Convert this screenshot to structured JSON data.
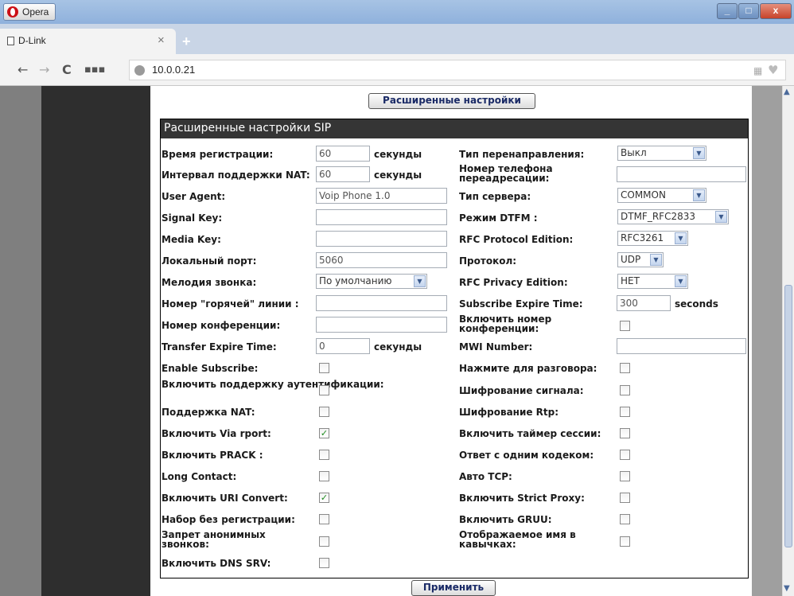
{
  "browser": {
    "menu_label": "Opera",
    "tab_title": "D-Link",
    "address": "10.0.0.21",
    "new_tab_glyph": "+",
    "close_glyph": "×"
  },
  "page": {
    "advanced_button": "Расширенные настройки",
    "section_title": "Расширенные настройки SIP",
    "apply_button": "Применить",
    "left": {
      "reg_time_label": "Время регистрации:",
      "reg_time_value": "60",
      "reg_time_unit": "секунды",
      "nat_interval_label": "Интервал поддержки NAT:",
      "nat_interval_value": "60",
      "nat_interval_unit": "секунды",
      "user_agent_label": "User Agent:",
      "user_agent_value": "Voip Phone 1.0",
      "signal_key_label": "Signal Key:",
      "signal_key_value": "",
      "media_key_label": "Media Key:",
      "media_key_value": "",
      "local_port_label": "Локальный порт:",
      "local_port_value": "5060",
      "ringtone_label": "Мелодия звонка:",
      "ringtone_value": "По умолчанию",
      "hotline_label": "Номер \"горячей\" линии :",
      "hotline_value": "",
      "conference_label": "Номер конференции:",
      "conference_value": "",
      "transfer_expire_label": "Transfer Expire Time:",
      "transfer_expire_value": "0",
      "transfer_expire_unit": "секунды",
      "enable_subscribe_label": "Enable Subscribe:",
      "enable_subscribe_checked": false,
      "auth_support_label": "Включить поддержку аутентификации:",
      "auth_support_checked": false,
      "nat_support_label": "Поддержка NAT:",
      "nat_support_checked": false,
      "via_rport_label": "Включить Via rport:",
      "via_rport_checked": true,
      "prack_label": "Включить PRACK :",
      "prack_checked": false,
      "long_contact_label": "Long Contact:",
      "long_contact_checked": false,
      "uri_convert_label": "Включить URI Convert:",
      "uri_convert_checked": true,
      "dial_no_reg_label": "Набор без регистрации:",
      "dial_no_reg_checked": false,
      "anon_block_label": "Запрет анонимных звонков:",
      "anon_block_checked": false,
      "dns_srv_label": "Включить DNS SRV:",
      "dns_srv_checked": false
    },
    "right": {
      "redirect_type_label": "Тип перенаправления:",
      "redirect_type_value": "Выкл",
      "redirect_number_label": "Номер телефона переадресации:",
      "redirect_number_value": "",
      "server_type_label": "Тип сервера:",
      "server_type_value": "COMMON",
      "dtmf_label": "Режим DTFM :",
      "dtmf_value": "DTMF_RFC2833",
      "rfc_protocol_label": "RFC Protocol Edition:",
      "rfc_protocol_value": "RFC3261",
      "protocol_label": "Протокол:",
      "protocol_value": "UDP",
      "rfc_privacy_label": "RFC Privacy Edition:",
      "rfc_privacy_value": "НЕТ",
      "subscribe_expire_label": "Subscribe Expire Time:",
      "subscribe_expire_value": "300",
      "subscribe_expire_unit": "seconds",
      "enable_conf_number_label": "Включить номер конференции:",
      "enable_conf_number_checked": false,
      "mwi_number_label": "MWI Number:",
      "mwi_number_value": "",
      "push_to_talk_label": "Нажмите для разговора:",
      "push_to_talk_checked": false,
      "signal_encryption_label": "Шифрование сигнала:",
      "signal_encryption_checked": false,
      "rtp_encryption_label": "Шифрование Rtp:",
      "rtp_encryption_checked": false,
      "session_timer_label": "Включить таймер сессии:",
      "session_timer_checked": false,
      "single_codec_label": "Ответ с одним кодеком:",
      "single_codec_checked": false,
      "auto_tcp_label": "Авто TCP:",
      "auto_tcp_checked": false,
      "strict_proxy_label": "Включить Strict Proxy:",
      "strict_proxy_checked": false,
      "gruu_label": "Включить GRUU:",
      "gruu_checked": false,
      "quoted_name_label": "Отображаемое имя в кавычках:",
      "quoted_name_checked": false
    }
  }
}
